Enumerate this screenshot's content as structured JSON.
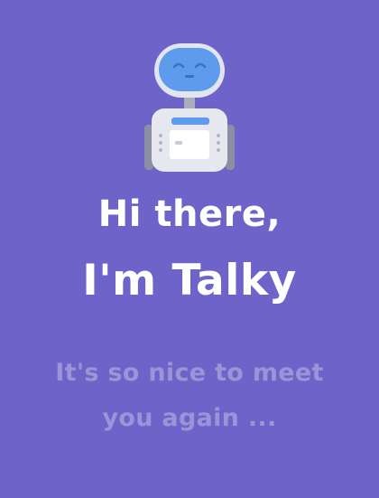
{
  "greeting": {
    "line1": "Hi there,",
    "line2": "I'm Talky"
  },
  "subtitle": {
    "line1": "It's so nice to meet",
    "line2": "you again ..."
  },
  "icons": {
    "mascot": "robot-mascot-icon"
  },
  "colors": {
    "background": "#6d63c9",
    "greeting_text": "#ffffff",
    "subtitle_text": "#9b94d6",
    "robot_face": "#5f9bec",
    "robot_body": "#e7e8ef"
  }
}
